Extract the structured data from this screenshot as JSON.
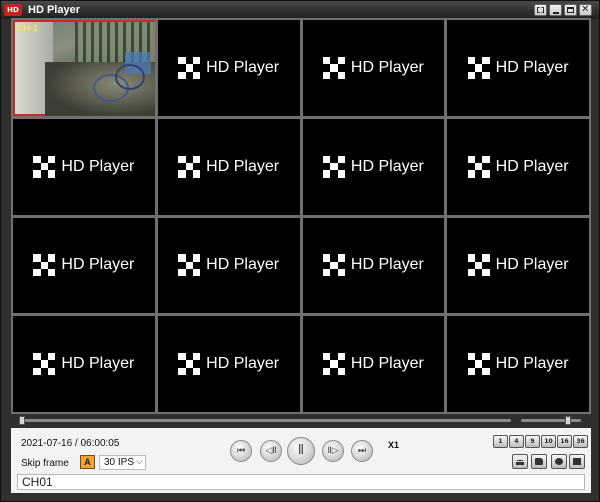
{
  "window": {
    "title": "HD Player",
    "logo_text": "HD",
    "buttons": [
      "fullscreen-icon",
      "minimize-icon",
      "maximize-icon",
      "close-icon"
    ],
    "close_glyph": "✕"
  },
  "grid": {
    "tile_label": "HD Player",
    "tile_icon": "hd-player-logo-icon",
    "active_channel": "CH-1",
    "active_color": "#c82a2a",
    "tile_count": 16
  },
  "playback": {
    "datetime": "2021-07-16 / 06:00:05",
    "skip_label": "Skip frame",
    "skip_icon_text": "A",
    "fps_value": "30 IPS",
    "fps_caret": "⌵",
    "speed": "X1",
    "buttons": [
      "first",
      "step-back",
      "pause",
      "step-forward",
      "last"
    ],
    "glyphs": {
      "first": "⏮",
      "stepback": "◁Ⅱ",
      "pause": "Ⅱ",
      "stepfwd": "Ⅱ▷",
      "last": "⏭"
    }
  },
  "layout_buttons": [
    "1",
    "4",
    "9",
    "10",
    "16",
    "36"
  ],
  "tools": [
    "export-icon",
    "folder-icon",
    "settings-icon",
    "print-icon"
  ],
  "status": {
    "channel": "CH01"
  }
}
